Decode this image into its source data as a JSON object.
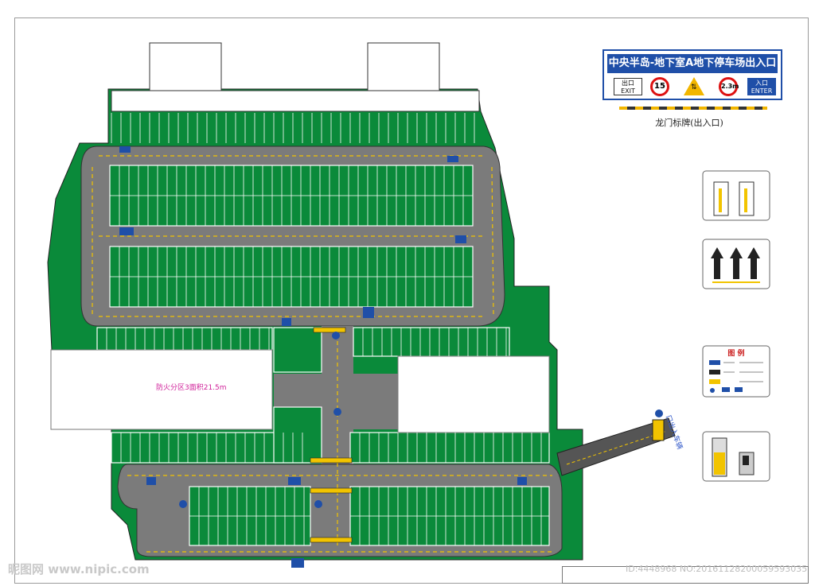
{
  "sign": {
    "title": "中央半岛-地下室A地下停车场出入口",
    "exit_label": "出口 EXIT",
    "speed_limit": "15",
    "height_limit": "2.3m",
    "enter_label": "入口 ENTER",
    "caption": "龙门标牌(出入口)"
  },
  "legend": {
    "title": "图 例"
  },
  "plan": {
    "fire_zone_label": "防火分区3面积21.5m",
    "entrance_label": "口出入车辆"
  },
  "watermark": {
    "left": "昵图网 www.nipic.com",
    "right": "ID:4448968 NO:20161128200059593035"
  },
  "colors": {
    "parking_green": "#0a8a3a",
    "road_gray": "#7b7b7b",
    "sign_blue": "#1f4fa8",
    "lane_yellow": "#f2c400"
  }
}
